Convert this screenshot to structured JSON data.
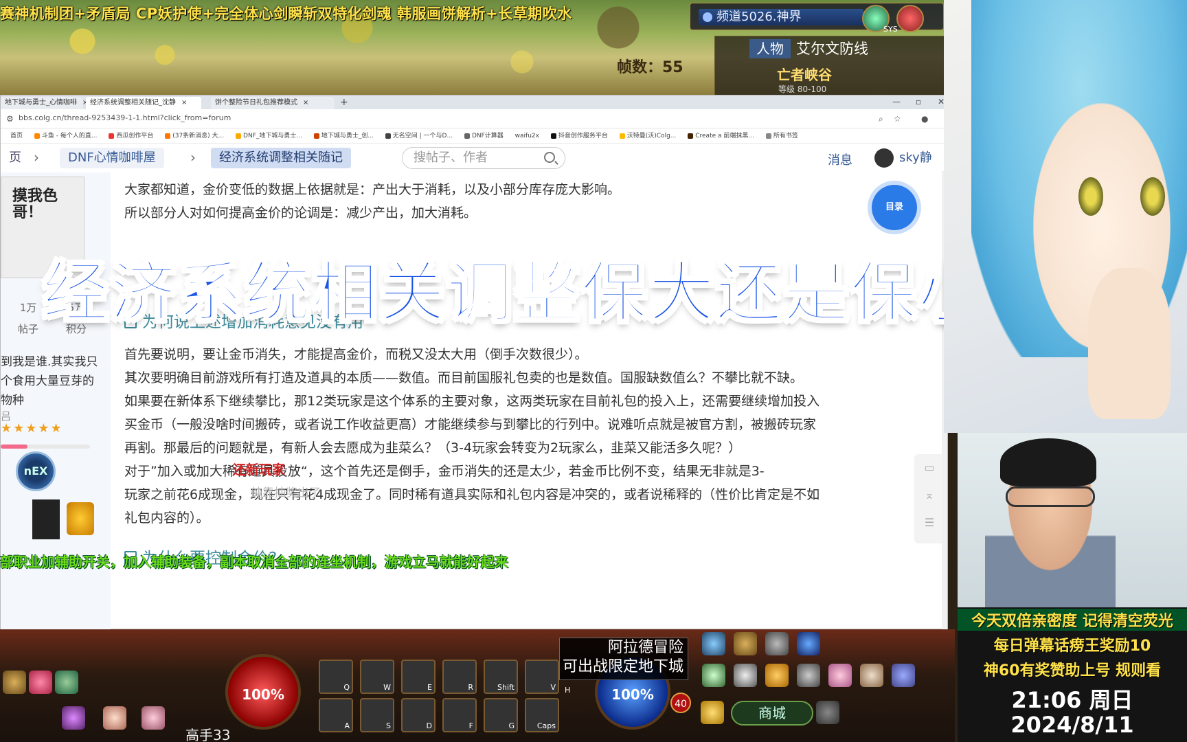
{
  "game": {
    "marquee": "赛神机制团+矛盾局  CP妖护使+完全体心剑瞬斩双特化剑魂  韩服画饼解析+长草期吹水",
    "fps_label": "帧数：55",
    "channel": "频道5026.神界",
    "sys_label": "SYS",
    "map_tab": "人物",
    "map_title": "艾尔文防线",
    "map_sub": "亡者峡谷",
    "map_level": "等级 80-100",
    "dungeon_notice": "阿拉德冒险\n可出战限定地下城",
    "hp_pct": "100%",
    "mp_pct": "100%",
    "shop": "商城",
    "level_text": "高手33",
    "badge_num": "40",
    "skill_keys": [
      "Q",
      "W",
      "E",
      "R",
      "Shift",
      "V",
      "H",
      "A",
      "S",
      "D",
      "F",
      "G",
      "Caps"
    ]
  },
  "browser": {
    "tabs": [
      {
        "label": "地下城与勇士_心情咖啡",
        "active": false
      },
      {
        "label": "经济系统调整相关随记_沈静",
        "active": true
      },
      {
        "label": "饼个整险节日礼包推荐模式",
        "active": false
      }
    ],
    "url": "bbs.colg.cn/thread-9253439-1-1.html?click_from=forum",
    "bookmarks": [
      "首页",
      "斗鱼 - 每个人的直...",
      "西瓜创作平台",
      "(37条新消息) 大...",
      "DNF_地下城与勇士...",
      "地下城与勇士_创...",
      "无名空间 | 一个与D...",
      "DNF计算器",
      "waifu2x",
      "抖音创作服务平台",
      "沃特曼(沃)Colg...",
      "Create a 前端抹黑...",
      "所有书签"
    ],
    "colors": {
      "accent": "#355a95",
      "heading": "#3b8a9a",
      "overlay": "#1a55e6"
    }
  },
  "forum": {
    "crumbs": [
      "页",
      "DNF心情咖啡屋",
      "经济系统调整相关随记"
    ],
    "search_placeholder": "搜帖子、作者",
    "messages": "消息",
    "username": "sky静",
    "toc": "目录"
  },
  "profile": {
    "avatar_text": "摸我色哥！",
    "posts_count": "1万",
    "posts_label": "帖子",
    "points_count": "5万",
    "points_label": "积分",
    "bio": "到我是谁.其实我只个食用大量豆芽的物种",
    "label_more": "吕",
    "stars": "★★★★★",
    "level_progress": 0.3
  },
  "article": {
    "p1": "大家都知道，金价变低的数据上依据就是：产出大于消耗，以及小部分库存庞大影响。",
    "p2": "所以部分人对如何提高金价的论调是：减少产出，加大消耗。",
    "h1": "为何说上述增加消耗意见没有用",
    "p3": "首先要说明，要让金币消失，才能提高金价，而税又没太大用（倒手次数很少）。",
    "p4": "其次要明确目前游戏所有打造及道具的本质——数值。而目前国服礼包卖的也是数值。国服缺数值么？不攀比就不缺。",
    "p5": "如果要在新体系下继续攀比，那12类玩家是这个体系的主要对象，这两类玩家在目前礼包的投入上，还需要继续增加投入",
    "p6": "买金币（一般没啥时间搬砖，或者说工作收益更高）才能继续参与到攀比的行列中。说难听点就是被官方割，被搬砖玩家",
    "p7": "再割。那最后的问题就是，有新人会去愿成为韭菜么？（3-4玩家会转变为2玩家么，韭菜又能活多久呢？）",
    "p8": "对于”加入或加大稀有道具投放“，这个首先还是倒手，金币消失的还是太少，若金币比例不变，结果无非就是3-",
    "p9": "玩家之前花6成现金，现在只有花4成现金了。同时稀有道具实际和礼包内容是冲突的，或者说稀释的（性价比肯定是不如",
    "p10": "礼包内容的）。",
    "h2": "为什么要控制金价?",
    "red_tag": "还新玩家",
    "faint": "纯靠抽奖出了"
  },
  "overlay": {
    "title": "经济系统相关调整保大还是保小",
    "danmaku": "部职业加辅助开关，加入辅助装备，副本取消全部的连坐机制，游戏立马就能好起来"
  },
  "stream": {
    "line1": "今天双倍亲密度 记得清空荧光",
    "line2": "每日弹幕话痨王奖励10",
    "line3": "神60有奖赞助上号 规则看",
    "time": "21:06 周日",
    "date": "2024/8/11"
  }
}
